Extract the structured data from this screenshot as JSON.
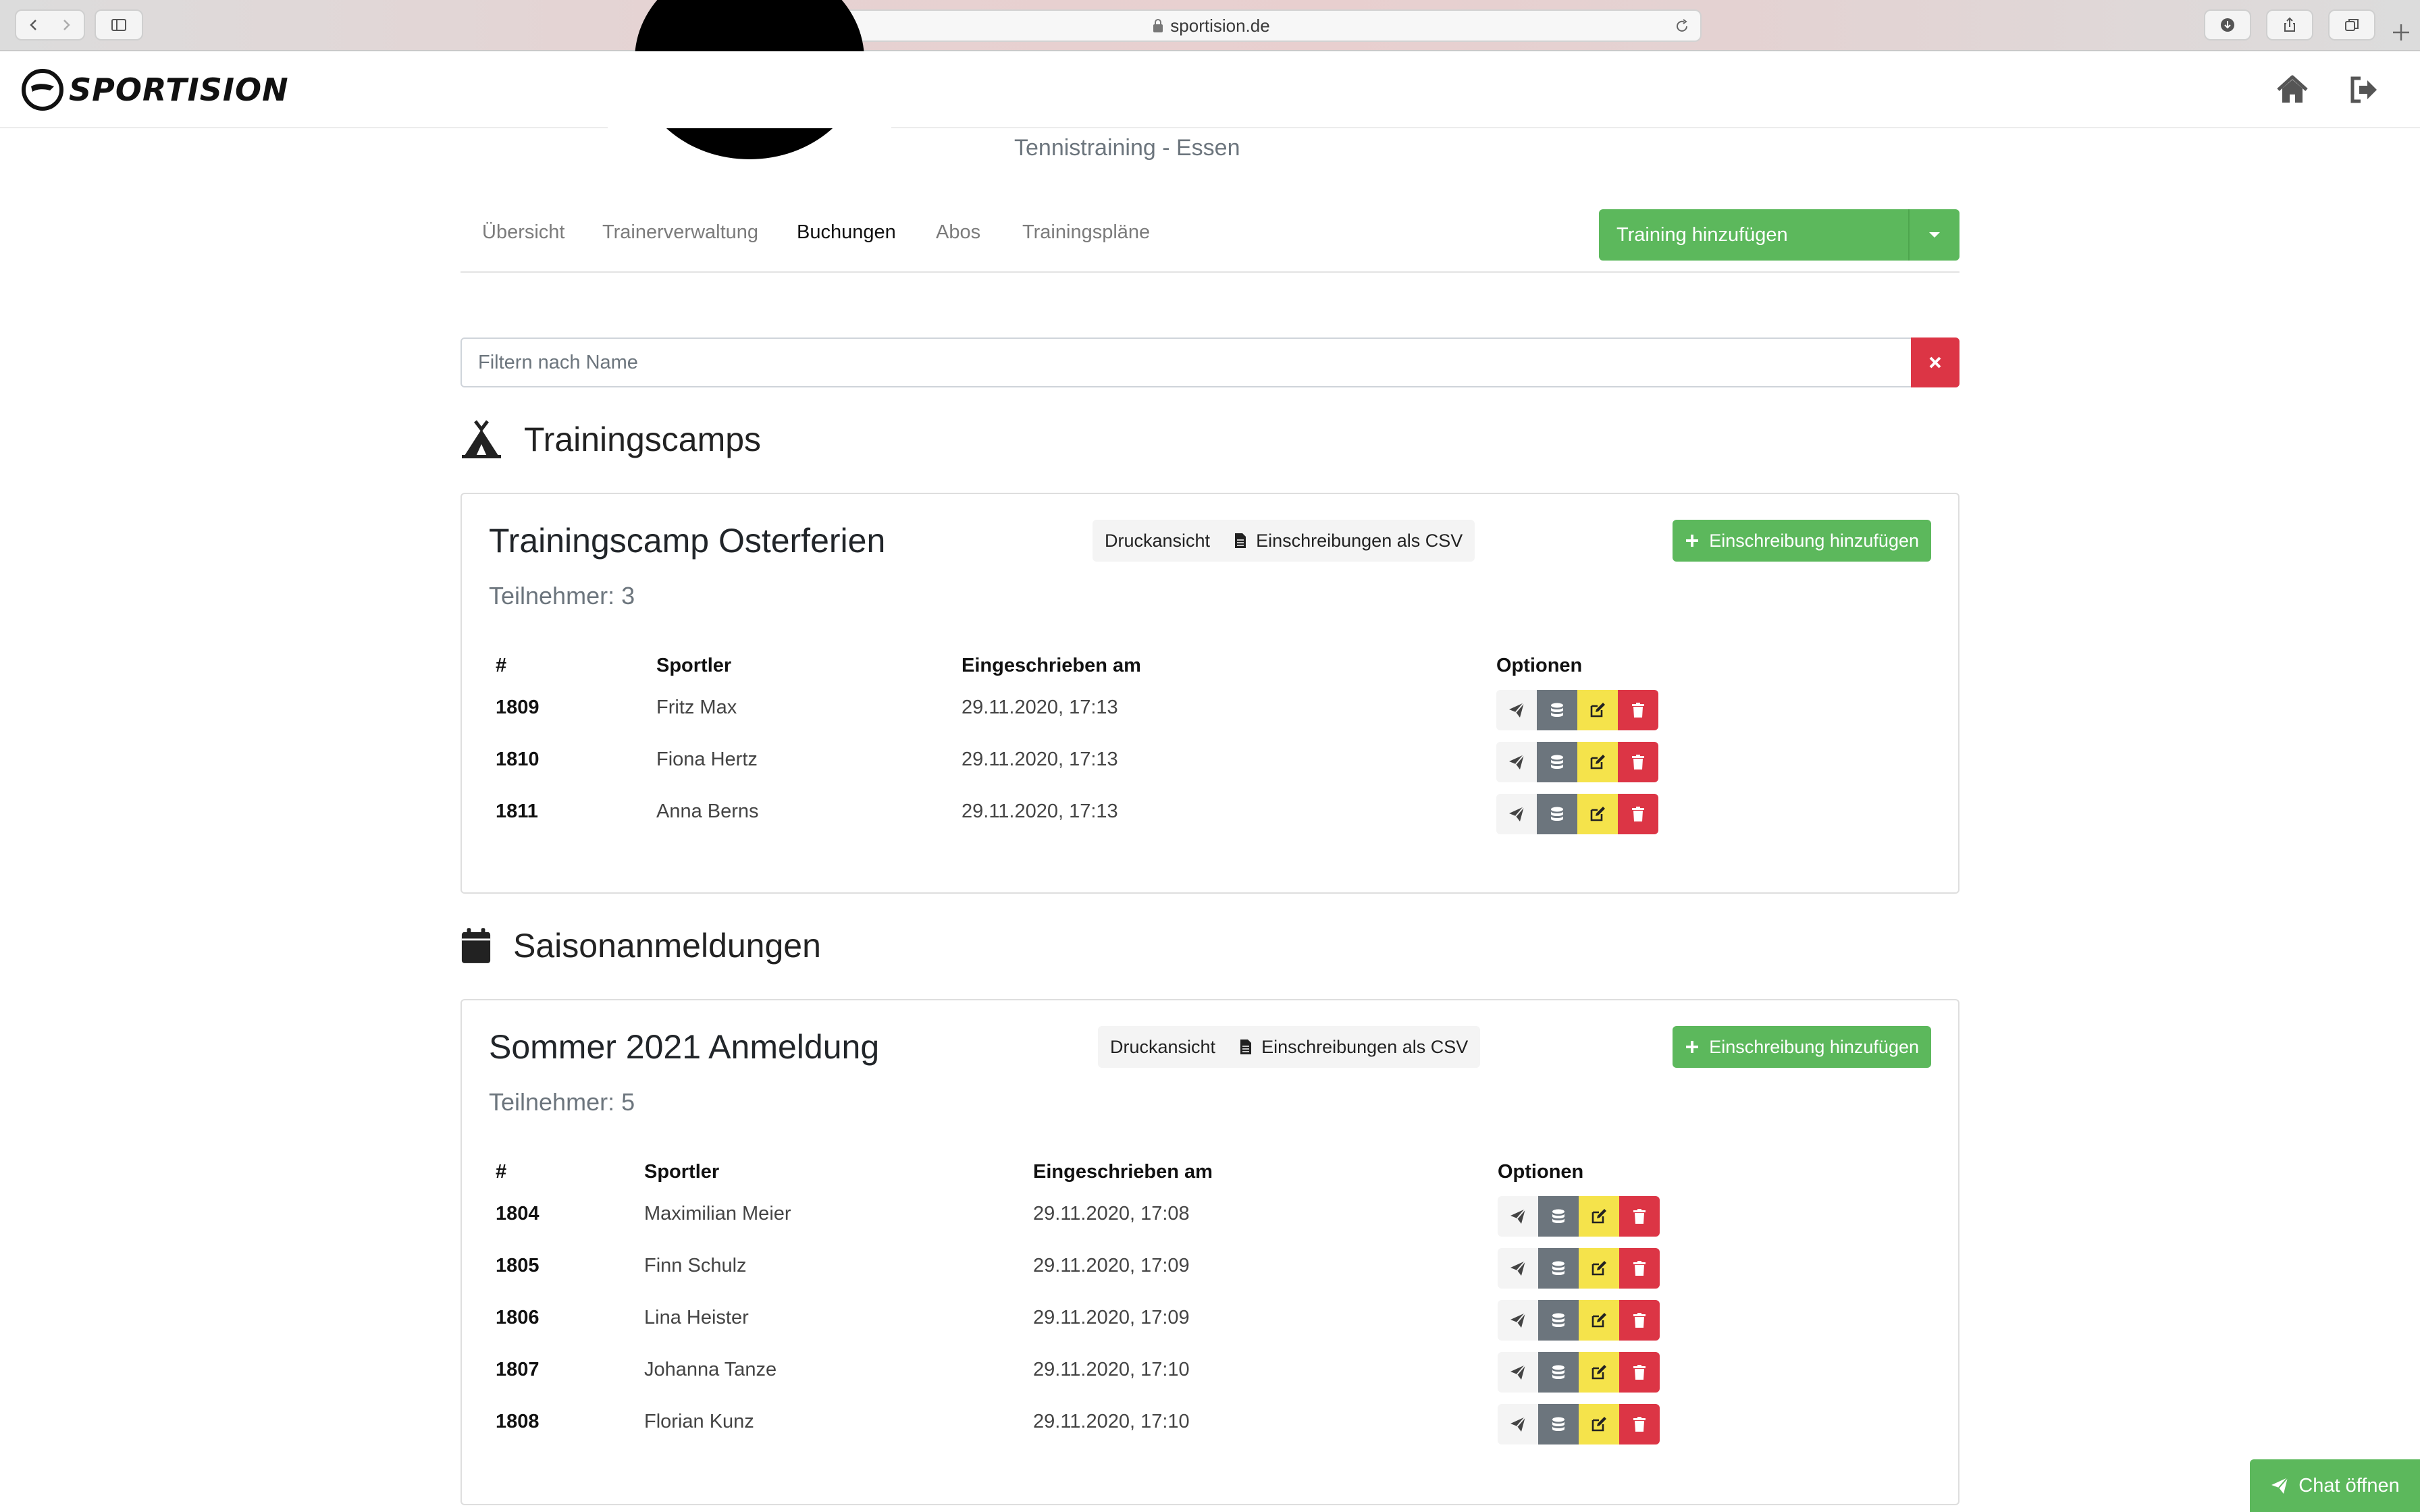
{
  "browser": {
    "url": "sportision.de"
  },
  "app": {
    "logo_text": "SPORTISION"
  },
  "profile": {
    "subtitle": "Tennistraining - Essen"
  },
  "nav": {
    "tabs": [
      {
        "label": "Übersicht"
      },
      {
        "label": "Trainerverwaltung"
      },
      {
        "label": "Buchungen"
      },
      {
        "label": "Abos"
      },
      {
        "label": "Trainingspläne"
      }
    ],
    "active_tab": "Buchungen",
    "add_training_label": "Training hinzufügen"
  },
  "filter": {
    "placeholder": "Filtern nach Name"
  },
  "camps": {
    "section_title": "Trainingscamps",
    "card": {
      "title": "Trainingscamp Osterferien",
      "count": "Teilnehmer: 3",
      "print_label": "Druckansicht",
      "csv_label": "Einschreibungen als CSV",
      "add_label": "Einschreibung hinzufügen",
      "columns": [
        "#",
        "Sportler",
        "Eingeschrieben am",
        "Optionen"
      ],
      "rows": [
        {
          "id": "1809",
          "name": "Fritz Max",
          "date": "29.11.2020, 17:13"
        },
        {
          "id": "1810",
          "name": "Fiona Hertz",
          "date": "29.11.2020, 17:13"
        },
        {
          "id": "1811",
          "name": "Anna Berns",
          "date": "29.11.2020, 17:13"
        }
      ]
    }
  },
  "season": {
    "section_title": "Saisonanmeldungen",
    "card": {
      "title": "Sommer 2021 Anmeldung",
      "count": "Teilnehmer: 5",
      "print_label": "Druckansicht",
      "csv_label": "Einschreibungen als CSV",
      "add_label": "Einschreibung hinzufügen",
      "columns": [
        "#",
        "Sportler",
        "Eingeschrieben am",
        "Optionen"
      ],
      "rows": [
        {
          "id": "1804",
          "name": "Maximilian Meier",
          "date": "29.11.2020, 17:08"
        },
        {
          "id": "1805",
          "name": "Finn Schulz",
          "date": "29.11.2020, 17:09"
        },
        {
          "id": "1806",
          "name": "Lina Heister",
          "date": "29.11.2020, 17:09"
        },
        {
          "id": "1807",
          "name": "Johanna Tanze",
          "date": "29.11.2020, 17:10"
        },
        {
          "id": "1808",
          "name": "Florian Kunz",
          "date": "29.11.2020, 17:10"
        }
      ]
    }
  },
  "chat": {
    "label": "Chat öffnen"
  },
  "colors": {
    "success": "#5cb85c",
    "danger": "#dc3545",
    "secondary": "#6c757d",
    "warning": "#f5e34b",
    "light": "#f4f4f4"
  },
  "icons": {
    "camp": "tent-icon",
    "season": "calendar-icon",
    "home": "home-icon",
    "logout": "sign-out-icon",
    "row_options": [
      "paper-plane-icon",
      "database-icon",
      "edit-icon",
      "trash-icon"
    ]
  }
}
